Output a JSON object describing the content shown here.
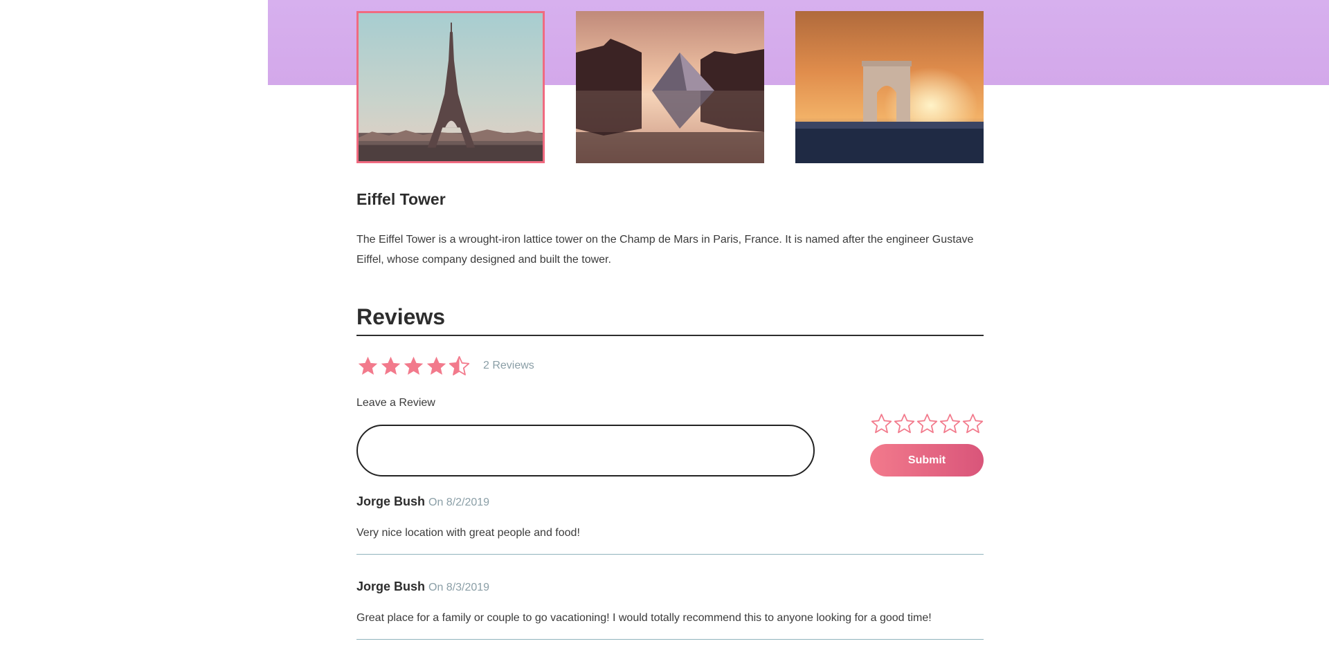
{
  "gallery": {
    "images": [
      {
        "name": "eiffel-tower-image",
        "selected": true
      },
      {
        "name": "louvre-pyramid-image",
        "selected": false
      },
      {
        "name": "arc-de-triomphe-image",
        "selected": false
      }
    ]
  },
  "place": {
    "title": "Eiffel Tower",
    "description": "The Eiffel Tower is a wrought-iron lattice tower on the Champ de Mars in Paris, France. It is named after the engineer Gustave Eiffel, whose company designed and built the tower."
  },
  "reviews": {
    "heading": "Reviews",
    "average_rating": 4.5,
    "max_rating": 5,
    "count_label": "2 Reviews",
    "leave_label": "Leave a Review",
    "input_value": "",
    "rating_input_value": 0,
    "submit_label": "Submit",
    "items": [
      {
        "author": "Jorge Bush",
        "date": "On 8/2/2019",
        "text": "Very nice location with great people and food!"
      },
      {
        "author": "Jorge Bush",
        "date": "On 8/3/2019",
        "text": "Great place for a family or couple to go vacationing! I would totally recommend this to anyone looking for a good time!"
      }
    ]
  },
  "colors": {
    "accent": "#f27a8c",
    "banner": "#d5acec",
    "muted_text": "#8a9ea6",
    "divider": "#8fb3bc"
  },
  "icons": {
    "star_filled": "star-icon",
    "star_half": "star-half-icon",
    "star_empty": "star-outline-icon"
  }
}
